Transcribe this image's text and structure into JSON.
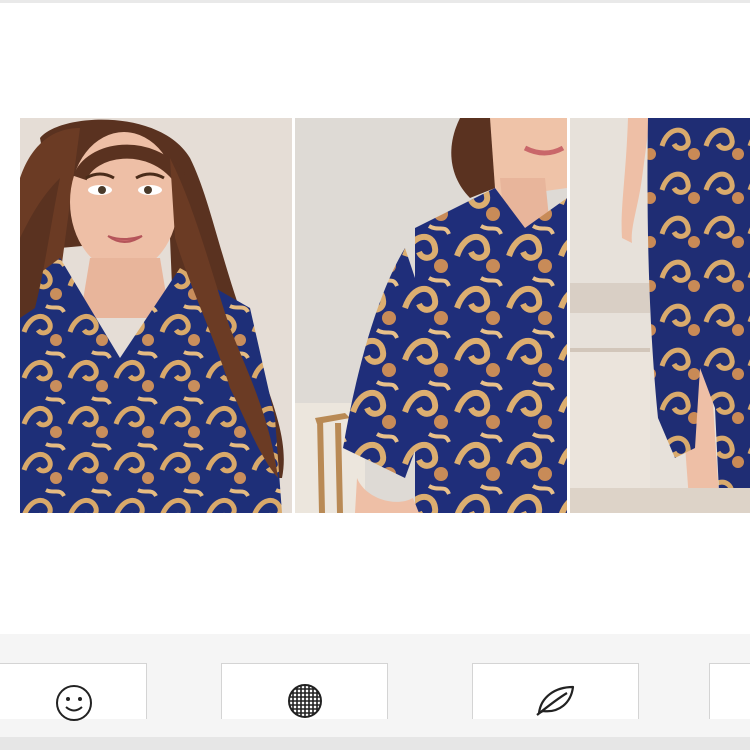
{
  "gallery": {
    "images": [
      {
        "icon": "model-portrait-photo"
      },
      {
        "icon": "robe-sleeve-detail-photo"
      },
      {
        "icon": "robe-hem-slit-photo"
      }
    ]
  },
  "feature_icons": [
    {
      "icon": "smiley-face-icon"
    },
    {
      "icon": "mesh-ball-icon"
    },
    {
      "icon": "leaf-icon"
    },
    {
      "icon": ""
    }
  ],
  "colors": {
    "robe_navy": "#1e2f78",
    "print_gold": "#d9a96a",
    "backdrop": "#e5ddd6"
  }
}
